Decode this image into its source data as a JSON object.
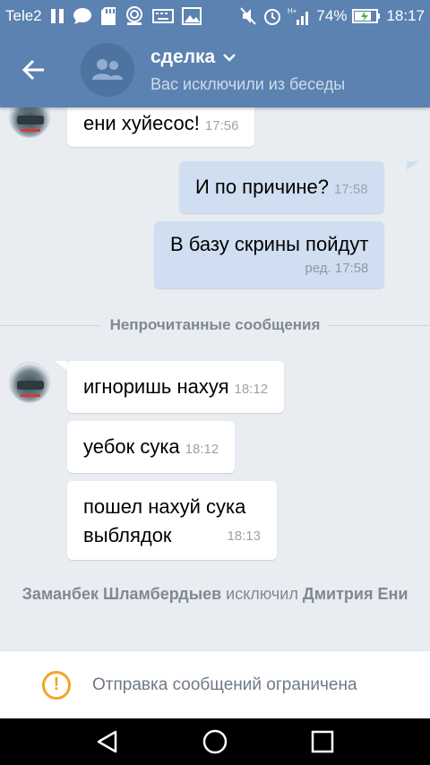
{
  "status_bar": {
    "carrier": "Tele2",
    "battery_percent": "74%",
    "time": "18:17",
    "icons": [
      "pause-icon",
      "chat-icon",
      "sd-card-icon",
      "radio-icon",
      "keyboard-icon",
      "image-icon",
      "mute-icon",
      "alarm-icon",
      "signal-icon",
      "battery-icon"
    ]
  },
  "header": {
    "title": "сделка",
    "subtitle": "Вас исключили из беседы",
    "accent_color": "#5b82b0"
  },
  "messages": [
    {
      "direction": "in",
      "text": "ени хуйесос!",
      "time": "17:56"
    },
    {
      "direction": "out",
      "text": "И по причине?",
      "time": "17:58"
    },
    {
      "direction": "out",
      "text": "В базу скрины пойдут",
      "meta": "ред. 17:58"
    },
    {
      "direction": "in",
      "text": "игноришь нахуя",
      "time": "18:12"
    },
    {
      "direction": "in",
      "text": "уебок сука",
      "time": "18:12"
    },
    {
      "direction": "in",
      "line1": "пошел нахуй сука",
      "line2": "выблядок",
      "time": "18:13"
    }
  ],
  "unread_divider": "Непрочитанные сообщения",
  "system_message": {
    "actor": "Заманбек Шламбердыев",
    "action": "исключил",
    "target": "Дмитрия Ени"
  },
  "restricted_bar": {
    "text": "Отправка сообщений ограничена",
    "icon": "warning-icon",
    "icon_color": "#f2a523"
  },
  "nav_bar": {
    "buttons": [
      "back-triangle-icon",
      "home-circle-icon",
      "recents-square-icon"
    ]
  }
}
